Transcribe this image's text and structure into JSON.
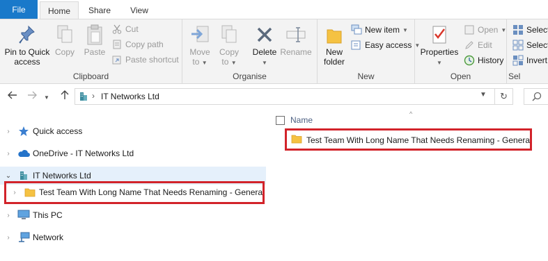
{
  "ribbon_tabs": {
    "file": "File",
    "home": "Home",
    "share": "Share",
    "view": "View"
  },
  "clipboard": {
    "pin_label_1": "Pin to Quick",
    "pin_label_2": "access",
    "copy": "Copy",
    "paste": "Paste",
    "cut": "Cut",
    "copy_path": "Copy path",
    "paste_shortcut": "Paste shortcut",
    "group_label": "Clipboard"
  },
  "organise": {
    "move_to_1": "Move",
    "move_to_2": "to",
    "copy_to_1": "Copy",
    "copy_to_2": "to",
    "delete": "Delete",
    "rename": "Rename",
    "group_label": "Organise"
  },
  "new_group": {
    "new_folder_1": "New",
    "new_folder_2": "folder",
    "new_item": "New item",
    "easy_access": "Easy access",
    "group_label": "New"
  },
  "open_group": {
    "properties": "Properties",
    "open": "Open",
    "edit": "Edit",
    "history": "History",
    "group_label": "Open"
  },
  "select_group": {
    "select_all": "Select",
    "select_none": "Select",
    "invert": "Invert",
    "group_label": "Sel"
  },
  "address": {
    "location": "IT Networks Ltd"
  },
  "nav_pane": {
    "quick_access": "Quick access",
    "onedrive": "OneDrive - IT Networks Ltd",
    "it_networks": "IT Networks Ltd",
    "team_folder": "Test Team With Long Name That Needs Renaming - General",
    "this_pc": "This PC",
    "network": "Network"
  },
  "content": {
    "column_name": "Name",
    "items": [
      {
        "name": "Test Team With Long Name That Needs Renaming - General"
      }
    ]
  },
  "colors": {
    "file_tab": "#1979ca",
    "highlight_box": "#d2232a",
    "selected_nav": "#e5f0fb",
    "folder": "#f5c242"
  }
}
